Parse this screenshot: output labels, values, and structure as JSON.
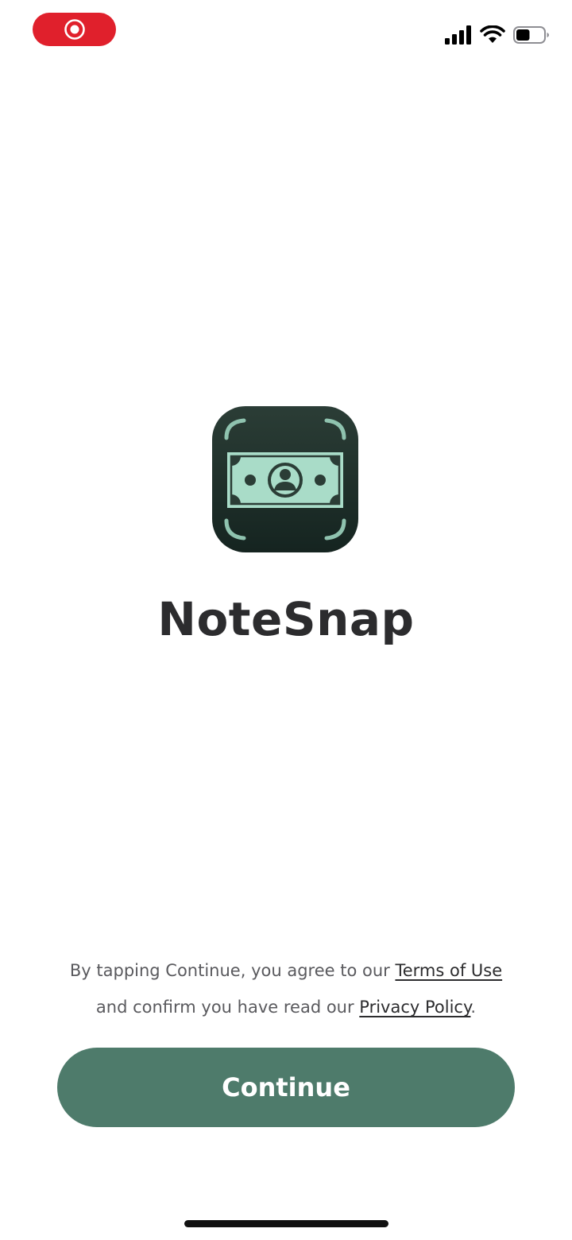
{
  "status_bar": {
    "recording_indicator_icon": "record-icon",
    "recording_color": "#e0202c",
    "signal_icon": "cellular-signal-icon",
    "wifi_icon": "wifi-icon",
    "battery_icon": "battery-icon",
    "battery_level": 0.5
  },
  "app": {
    "icon": "banknote-scan-icon",
    "name": "NoteSnap"
  },
  "legal": {
    "prefix": "By tapping Continue, you agree to our ",
    "terms_link": "Terms of Use",
    "middle": "and confirm you have read our ",
    "privacy_link": "Privacy Policy",
    "suffix": "."
  },
  "actions": {
    "continue_label": "Continue"
  },
  "colors": {
    "accent": "#4e7b6b",
    "icon_background": "#1e2e28",
    "icon_foreground": "#a9dcc8"
  }
}
